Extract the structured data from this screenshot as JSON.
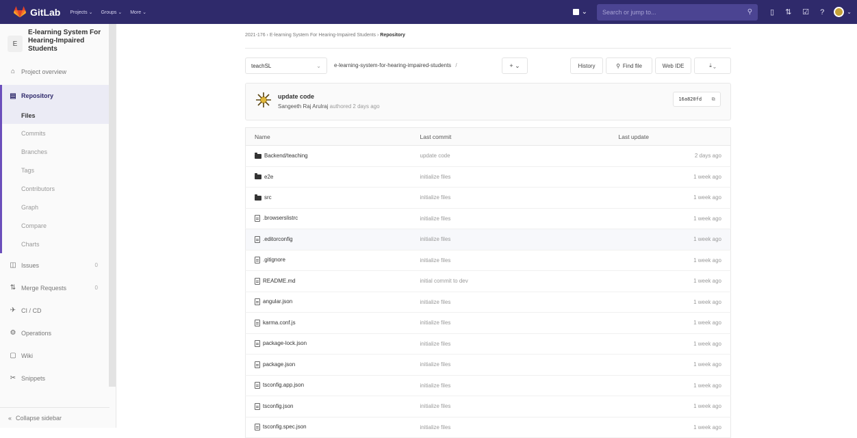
{
  "navbar": {
    "brand": "GitLab",
    "menu": [
      "Projects ⌄",
      "Groups ⌄",
      "More ⌄"
    ],
    "search_placeholder": "Search or jump to..."
  },
  "sidebar": {
    "project_badge": "E",
    "project_name": "E-learning System For Hearing-Impaired Students",
    "overview": "Project overview",
    "repository": "Repository",
    "repo_items": [
      "Files",
      "Commits",
      "Branches",
      "Tags",
      "Contributors",
      "Graph",
      "Compare",
      "Charts"
    ],
    "issues": "Issues",
    "issues_count": "0",
    "merge_requests": "Merge Requests",
    "mr_count": "0",
    "cicd": "CI / CD",
    "operations": "Operations",
    "wiki": "Wiki",
    "snippets": "Snippets",
    "collapse": "Collapse sidebar"
  },
  "breadcrumb": {
    "group": "2021-176",
    "project": "E-learning System For Hearing-Impaired Students",
    "current": "Repository"
  },
  "toolbar": {
    "branch": "teachSL",
    "path": "e-learning-system-for-hearing-impaired-students",
    "path_sep": "/",
    "history": "History",
    "find_file": "Find file",
    "web_ide": "Web IDE"
  },
  "commit": {
    "title": "update code",
    "author": "Sangeeth Raj Arulraj",
    "meta": "authored 2 days ago",
    "sha": "16a820fd"
  },
  "table": {
    "headers": [
      "Name",
      "Last commit",
      "Last update"
    ],
    "rows": [
      {
        "name": "Backend/teaching",
        "type": "folder",
        "commit": "update code",
        "update": "2 days ago"
      },
      {
        "name": "e2e",
        "type": "folder",
        "commit": "initialize files",
        "update": "1 week ago"
      },
      {
        "name": "src",
        "type": "folder",
        "commit": "initialize files",
        "update": "1 week ago"
      },
      {
        "name": ".browserslistrc",
        "type": "file",
        "commit": "initialize files",
        "update": "1 week ago"
      },
      {
        "name": ".editorconfig",
        "type": "file",
        "commit": "initialize files",
        "update": "1 week ago"
      },
      {
        "name": ".gitignore",
        "type": "file",
        "commit": "initialize files",
        "update": "1 week ago"
      },
      {
        "name": "README.md",
        "type": "file",
        "commit": "initial commit to dev",
        "update": "1 week ago"
      },
      {
        "name": "angular.json",
        "type": "file",
        "commit": "initialize files",
        "update": "1 week ago"
      },
      {
        "name": "karma.conf.js",
        "type": "file",
        "commit": "initialize files",
        "update": "1 week ago"
      },
      {
        "name": "package-lock.json",
        "type": "file",
        "commit": "initialize files",
        "update": "1 week ago"
      },
      {
        "name": "package.json",
        "type": "file",
        "commit": "initialize files",
        "update": "1 week ago"
      },
      {
        "name": "tsconfig.app.json",
        "type": "file",
        "commit": "initialize files",
        "update": "1 week ago"
      },
      {
        "name": "tsconfig.json",
        "type": "file",
        "commit": "initialize files",
        "update": "1 week ago"
      },
      {
        "name": "tsconfig.spec.json",
        "type": "file",
        "commit": "initialize files",
        "update": "1 week ago"
      }
    ]
  },
  "colors": {
    "navbar": "#2f2a6b",
    "accent": "#6b4fbb",
    "logo_orange": "#e24329"
  }
}
